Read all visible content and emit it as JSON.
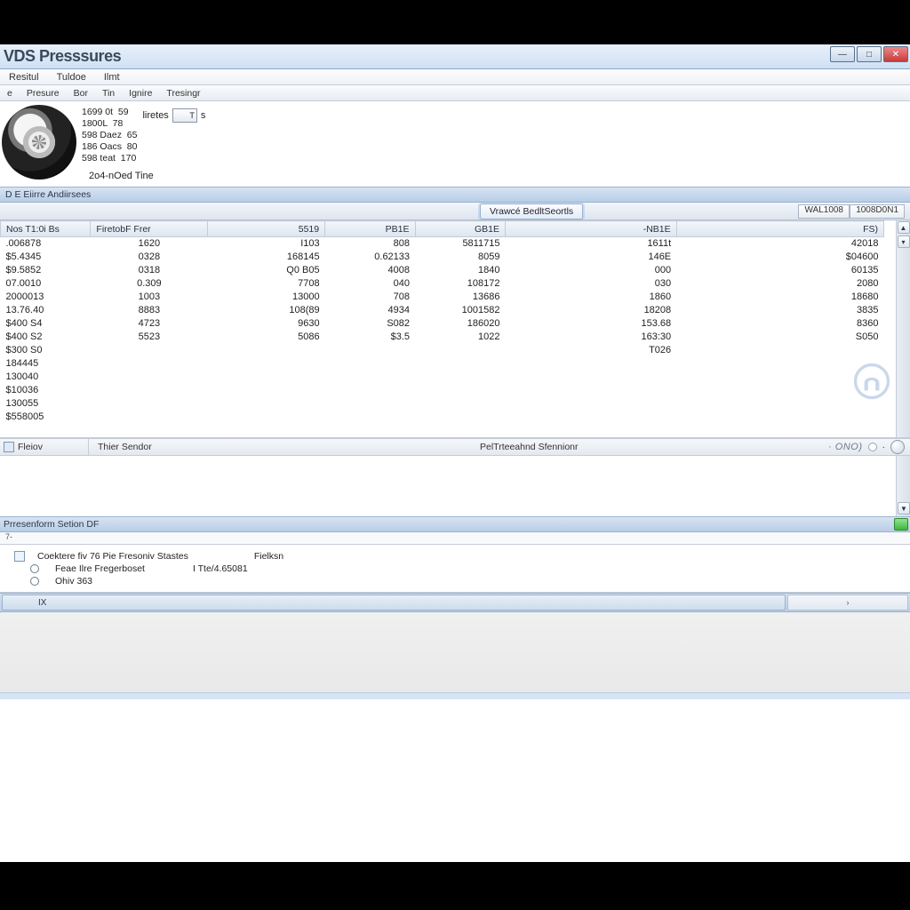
{
  "window": {
    "title": "VDS Presssures",
    "buttons": {
      "min": "—",
      "max": "□",
      "close": "✕"
    }
  },
  "menubar": [
    "Resitul",
    "Tuldoe",
    "Ilmt"
  ],
  "toolbar": [
    "e",
    "Presure",
    "Bor",
    "Tin",
    "Ignire",
    "Tresingr"
  ],
  "header": {
    "specs": "1699 0t  59\n1800L  78\n598 Daez  65\n186 Oacs  80\n598 teat  170",
    "caption": "2o4-nOed Tine",
    "units_label": "liretes",
    "units_value": "T",
    "units_suffix": "s"
  },
  "panel1": {
    "title": "D E  Eiirre Andiirsees",
    "center_button": "Vrawcé BedltSeortls",
    "right_button1": "WAL1008",
    "right_button2": "1008D0N1",
    "columns": [
      "Nos T1:0i Bs",
      "FiretobF Frer",
      "5519",
      "PB1E",
      "GB1E",
      "-NB1E",
      "FS)"
    ],
    "rows": [
      [
        ".006878",
        "1620",
        "I103",
        "808",
        "5811715",
        "1611t",
        "42018"
      ],
      [
        "$5.4345",
        "0328",
        "168145",
        "0.62133",
        "8059",
        "146E",
        "$04600"
      ],
      [
        "$9.5852",
        "0318",
        "Q0 B05",
        "4008",
        "1840",
        "000",
        "60135"
      ],
      [
        "07.0010",
        "0.309",
        "7708",
        "040",
        "108172",
        "030",
        "2080"
      ],
      [
        "2000013",
        "1003",
        "13000",
        "708",
        "13686",
        "1860",
        "18680"
      ],
      [
        "13.76.40",
        "8883",
        "108(89",
        "4934",
        "1001582",
        "18208",
        "3835"
      ],
      [
        "$400 S4",
        "4723",
        "9630",
        "S082",
        "186020",
        "153.68",
        "8360"
      ],
      [
        "$400 S2",
        "5523",
        "5086",
        "$3.5",
        "1022",
        "163:30",
        "S050"
      ],
      [
        "$300 S0",
        "",
        "",
        "",
        "",
        "T026",
        ""
      ],
      [
        "184445",
        "",
        "",
        "",
        "",
        "",
        ""
      ],
      [
        "130040",
        "",
        "",
        "",
        "",
        "",
        ""
      ],
      [
        "$10036",
        "",
        "",
        "",
        "",
        "",
        ""
      ],
      [
        "130055",
        "",
        "",
        "",
        "",
        "",
        ""
      ],
      [
        "$558005",
        "",
        "",
        "",
        "",
        "",
        ""
      ]
    ],
    "status": {
      "left": "Fleiov",
      "mid": "Thier Sendor",
      "mid2": "PelTrteeahnd Sfennionr",
      "right": "· ONO)"
    }
  },
  "panel2": {
    "title": "Prresenform Setion DF",
    "tab": "7-",
    "group_label": "Coektere fiv 76 Pie Fresoniv Stastes",
    "col2_label": "Fielksn",
    "radio1": "Feae Ilre Fregerboset",
    "radio1_value": "I Tte/4.65081",
    "radio2": "Ohiv 363",
    "mini_left": "IX",
    "mini_right": "›"
  }
}
